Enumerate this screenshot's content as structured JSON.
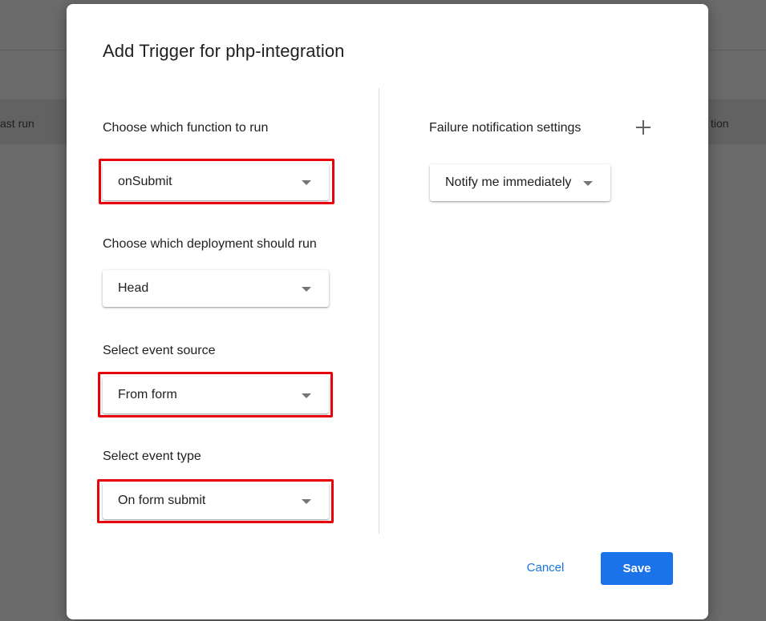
{
  "background": {
    "column_last_run": "ast run",
    "column_function": "tion"
  },
  "dialog": {
    "title": "Add Trigger for php-integration",
    "function_section": {
      "label": "Choose which function to run",
      "selected": "onSubmit"
    },
    "deployment_section": {
      "label": "Choose which deployment should run",
      "selected": "Head"
    },
    "event_source_section": {
      "label": "Select event source",
      "selected": "From form"
    },
    "event_type_section": {
      "label": "Select event type",
      "selected": "On form submit"
    },
    "failure_notification": {
      "label": "Failure notification settings",
      "add_icon": "plus-icon",
      "selected": "Notify me immediately"
    },
    "buttons": {
      "cancel": "Cancel",
      "save": "Save"
    }
  },
  "colors": {
    "accent": "#1a73e8",
    "highlight_border": "#e8000b",
    "overlay": "#6b6b6b"
  }
}
